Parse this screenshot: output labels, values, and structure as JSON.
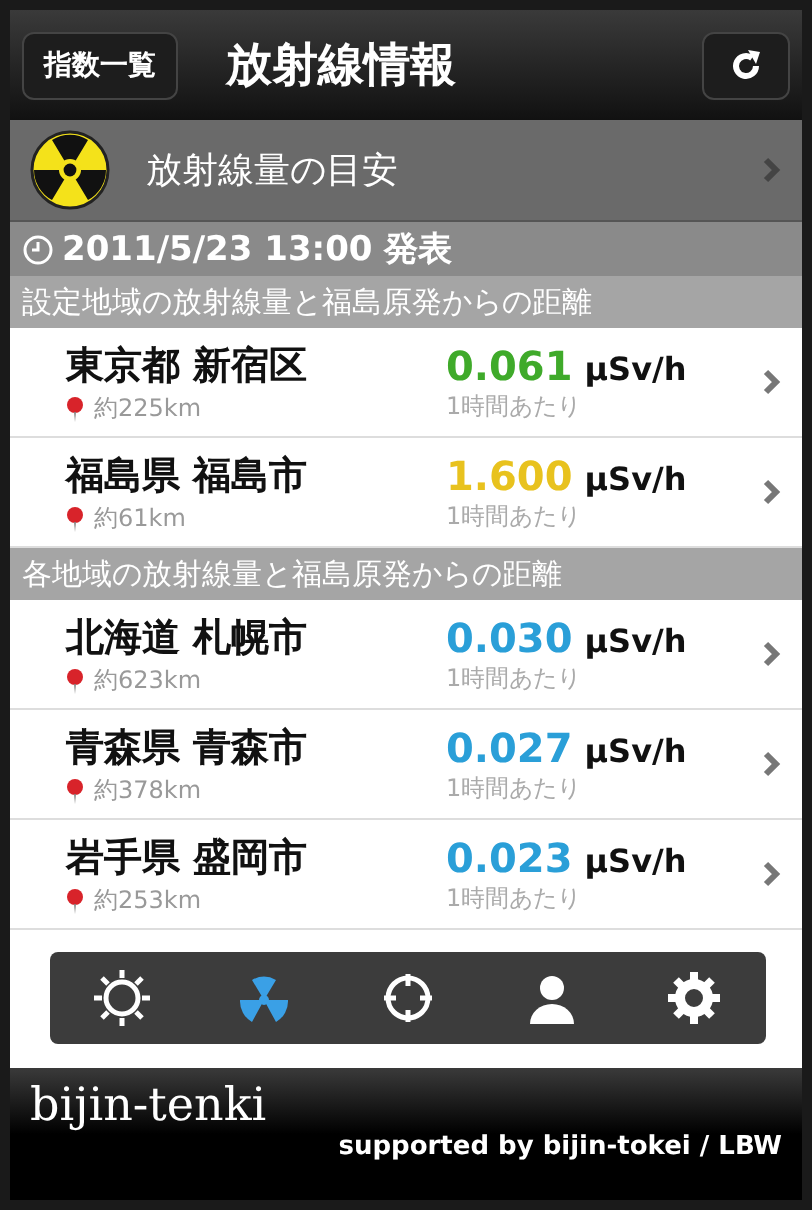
{
  "nav_bar": {
    "back_button": "指数一覧",
    "title": "放射線情報"
  },
  "guide_row": {
    "label": "放射線量の目安"
  },
  "published": {
    "text": "2011/5/23 13:00 発表"
  },
  "sections": [
    {
      "header": "設定地域の放射線量と福島原発からの距離",
      "rows": [
        {
          "place": "東京都 新宿区",
          "distance": "約225km",
          "value": "0.061",
          "unit": "µSv/h",
          "per": "1時間あたり",
          "color": "#3faa2a"
        },
        {
          "place": "福島県 福島市",
          "distance": "約61km",
          "value": "1.600",
          "unit": "µSv/h",
          "per": "1時間あたり",
          "color": "#e8c21e"
        }
      ]
    },
    {
      "header": "各地域の放射線量と福島原発からの距離",
      "rows": [
        {
          "place": "北海道 札幌市",
          "distance": "約623km",
          "value": "0.030",
          "unit": "µSv/h",
          "per": "1時間あたり",
          "color": "#2a9fd8"
        },
        {
          "place": "青森県 青森市",
          "distance": "約378km",
          "value": "0.027",
          "unit": "µSv/h",
          "per": "1時間あたり",
          "color": "#2a9fd8"
        },
        {
          "place": "岩手県 盛岡市",
          "distance": "約253km",
          "value": "0.023",
          "unit": "µSv/h",
          "per": "1時間あたり",
          "color": "#2a9fd8"
        }
      ]
    }
  ],
  "tab_bar": [
    {
      "kind": "sun",
      "selected": false
    },
    {
      "kind": "radiation",
      "selected": true
    },
    {
      "kind": "target",
      "selected": false
    },
    {
      "kind": "person",
      "selected": false
    },
    {
      "kind": "gear",
      "selected": false
    }
  ],
  "footer": {
    "brand": "bijin-tenki",
    "credit": "supported by bijin-tokei / LBW"
  }
}
